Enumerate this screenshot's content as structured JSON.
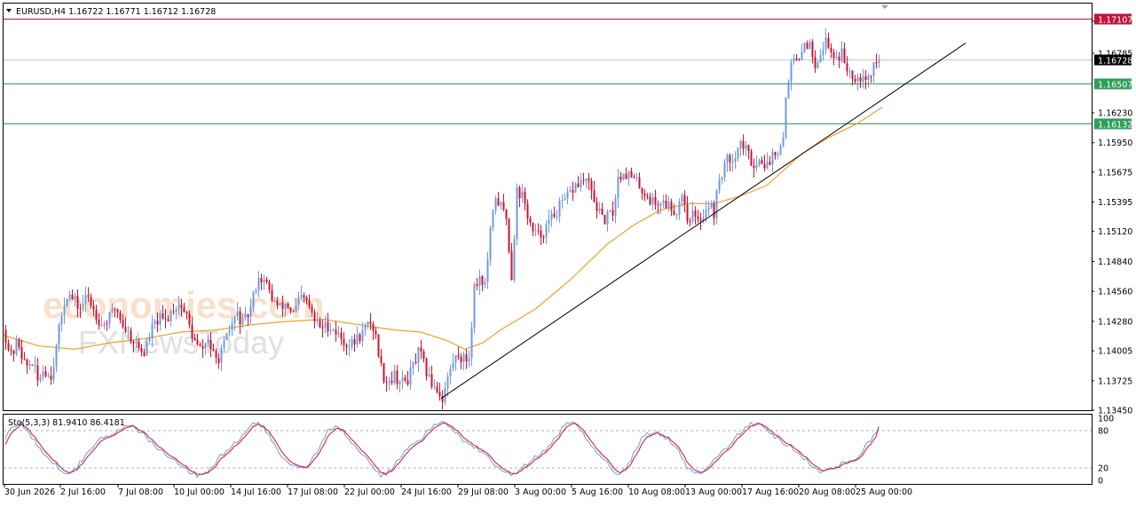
{
  "header": {
    "symbol_line": "EURUSD,H4  1.16722 1.16771 1.16712 1.16728"
  },
  "watermark": {
    "line1": "economies.com",
    "line2": "FXNewsToday"
  },
  "colors": {
    "bull": "#6f9ae0",
    "bear": "#d0112b",
    "ma": "#f0a030",
    "trend": "#000000",
    "support": "#2e9e5a",
    "resistance": "#c0143c",
    "current": "#000000",
    "stoch_main": "#6f9ae0",
    "stoch_signal": "#d0112b"
  },
  "chart_data": [
    {
      "type": "candlestick",
      "symbol": "EURUSD",
      "timeframe": "H4",
      "ohlc_last": {
        "open": 1.16722,
        "high": 1.16771,
        "low": 1.16712,
        "close": 1.16728
      },
      "ylim": [
        1.1345,
        1.1725
      ],
      "y_ticks": [
        "1.17085",
        "1.16785",
        "1.16230",
        "1.15950",
        "1.15675",
        "1.15395",
        "1.15120",
        "1.14840",
        "1.14560",
        "1.14280",
        "1.14005",
        "1.13725",
        "1.13450"
      ],
      "x_ticks": [
        "30 Jun 2026",
        "2 Jul 16:00",
        "7 Jul 08:00",
        "10 Jul 00:00",
        "14 Jul 16:00",
        "17 Jul 08:00",
        "22 Jul 00:00",
        "24 Jul 16:00",
        "29 Jul 08:00",
        "3 Aug 00:00",
        "5 Aug 16:00",
        "10 Aug 08:00",
        "13 Aug 00:00",
        "17 Aug 16:00",
        "20 Aug 08:00",
        "25 Aug 00:00"
      ],
      "horizontal_levels": [
        {
          "label": "1.17107",
          "value": 1.17107,
          "role": "resistance"
        },
        {
          "label": "1.16728",
          "value": 1.16728,
          "role": "current"
        },
        {
          "label": "1.16507",
          "value": 1.16507,
          "role": "support"
        },
        {
          "label": "1.16132",
          "value": 1.16132,
          "role": "support"
        }
      ],
      "close_path": [
        [
          0,
          1.142
        ],
        [
          8,
          1.1395
        ],
        [
          16,
          1.141
        ],
        [
          24,
          1.1385
        ],
        [
          32,
          1.139
        ],
        [
          38,
          1.1372
        ],
        [
          45,
          1.1385
        ],
        [
          52,
          1.1375
        ],
        [
          58,
          1.1398
        ],
        [
          64,
          1.143
        ],
        [
          70,
          1.1455
        ],
        [
          78,
          1.1448
        ],
        [
          86,
          1.144
        ],
        [
          94,
          1.1452
        ],
        [
          102,
          1.1438
        ],
        [
          110,
          1.1425
        ],
        [
          118,
          1.143
        ],
        [
          126,
          1.1442
        ],
        [
          134,
          1.1425
        ],
        [
          142,
          1.1415
        ],
        [
          150,
          1.1405
        ],
        [
          158,
          1.1398
        ],
        [
          166,
          1.142
        ],
        [
          174,
          1.143
        ],
        [
          182,
          1.1428
        ],
        [
          190,
          1.144
        ],
        [
          198,
          1.1445
        ],
        [
          206,
          1.1432
        ],
        [
          214,
          1.141
        ],
        [
          222,
          1.14
        ],
        [
          230,
          1.1412
        ],
        [
          238,
          1.139
        ],
        [
          246,
          1.14
        ],
        [
          254,
          1.142
        ],
        [
          262,
          1.1435
        ],
        [
          270,
          1.1425
        ],
        [
          278,
          1.144
        ],
        [
          286,
          1.147
        ],
        [
          294,
          1.1465
        ],
        [
          302,
          1.145
        ],
        [
          310,
          1.144
        ],
        [
          318,
          1.1445
        ],
        [
          326,
          1.1435
        ],
        [
          334,
          1.145
        ],
        [
          342,
          1.1445
        ],
        [
          350,
          1.1428
        ],
        [
          358,
          1.1422
        ],
        [
          366,
          1.1425
        ],
        [
          374,
          1.1418
        ],
        [
          382,
          1.141
        ],
        [
          390,
          1.1405
        ],
        [
          398,
          1.1412
        ],
        [
          406,
          1.142
        ],
        [
          414,
          1.1428
        ],
        [
          420,
          1.141
        ],
        [
          426,
          1.138
        ],
        [
          432,
          1.1372
        ],
        [
          440,
          1.1378
        ],
        [
          448,
          1.137
        ],
        [
          456,
          1.1375
        ],
        [
          462,
          1.1388
        ],
        [
          468,
          1.14
        ],
        [
          474,
          1.1385
        ],
        [
          480,
          1.1372
        ],
        [
          486,
          1.1368
        ],
        [
          494,
          1.1356
        ],
        [
          500,
          1.1375
        ],
        [
          506,
          1.139
        ],
        [
          512,
          1.1398
        ],
        [
          518,
          1.1392
        ],
        [
          524,
          1.1395
        ],
        [
          530,
          1.146
        ],
        [
          536,
          1.147
        ],
        [
          542,
          1.1462
        ],
        [
          548,
          1.151
        ],
        [
          554,
          1.1545
        ],
        [
          560,
          1.1535
        ],
        [
          566,
          1.1525
        ],
        [
          572,
          1.147
        ],
        [
          578,
          1.155
        ],
        [
          584,
          1.1545
        ],
        [
          590,
          1.1528
        ],
        [
          596,
          1.151
        ],
        [
          602,
          1.1508
        ],
        [
          608,
          1.1512
        ],
        [
          614,
          1.152
        ],
        [
          620,
          1.1528
        ],
        [
          626,
          1.1535
        ],
        [
          632,
          1.154
        ],
        [
          638,
          1.1548
        ],
        [
          644,
          1.1555
        ],
        [
          650,
          1.1558
        ],
        [
          656,
          1.156
        ],
        [
          662,
          1.1548
        ],
        [
          668,
          1.1535
        ],
        [
          674,
          1.1522
        ],
        [
          680,
          1.1525
        ],
        [
          686,
          1.153
        ],
        [
          692,
          1.1562
        ],
        [
          698,
          1.1568
        ],
        [
          704,
          1.1565
        ],
        [
          710,
          1.156
        ],
        [
          716,
          1.1555
        ],
        [
          722,
          1.1548
        ],
        [
          728,
          1.1542
        ],
        [
          734,
          1.1538
        ],
        [
          740,
          1.154
        ],
        [
          746,
          1.1538
        ],
        [
          752,
          1.1535
        ],
        [
          758,
          1.153
        ],
        [
          764,
          1.155
        ],
        [
          770,
          1.1525
        ],
        [
          776,
          1.1528
        ],
        [
          782,
          1.152
        ],
        [
          788,
          1.153
        ],
        [
          794,
          1.1538
        ],
        [
          800,
          1.153
        ],
        [
          806,
          1.156
        ],
        [
          812,
          1.1575
        ],
        [
          818,
          1.158
        ],
        [
          824,
          1.1585
        ],
        [
          830,
          1.1595
        ],
        [
          836,
          1.1588
        ],
        [
          842,
          1.1578
        ],
        [
          848,
          1.1575
        ],
        [
          854,
          1.158
        ],
        [
          860,
          1.1572
        ],
        [
          866,
          1.1585
        ],
        [
          872,
          1.159
        ],
        [
          878,
          1.16
        ],
        [
          882,
          1.165
        ],
        [
          886,
          1.1665
        ],
        [
          890,
          1.1672
        ],
        [
          896,
          1.1668
        ],
        [
          902,
          1.169
        ],
        [
          908,
          1.1685
        ],
        [
          914,
          1.167
        ],
        [
          920,
          1.168
        ],
        [
          926,
          1.169
        ],
        [
          932,
          1.168
        ],
        [
          938,
          1.1675
        ],
        [
          944,
          1.1678
        ],
        [
          950,
          1.1665
        ],
        [
          956,
          1.166
        ],
        [
          962,
          1.1656
        ],
        [
          968,
          1.166
        ],
        [
          974,
          1.1655
        ],
        [
          980,
          1.1668
        ],
        [
          986,
          1.1672
        ],
        [
          990,
          1.16728
        ]
      ],
      "moving_average": [
        [
          0,
          1.1415
        ],
        [
          40,
          1.1405
        ],
        [
          80,
          1.1402
        ],
        [
          120,
          1.1408
        ],
        [
          160,
          1.1412
        ],
        [
          200,
          1.1418
        ],
        [
          240,
          1.142
        ],
        [
          280,
          1.1425
        ],
        [
          320,
          1.1428
        ],
        [
          360,
          1.143
        ],
        [
          400,
          1.1425
        ],
        [
          440,
          1.142
        ],
        [
          470,
          1.1418
        ],
        [
          500,
          1.141
        ],
        [
          520,
          1.1402
        ],
        [
          540,
          1.1408
        ],
        [
          560,
          1.142
        ],
        [
          600,
          1.144
        ],
        [
          640,
          1.1468
        ],
        [
          680,
          1.15
        ],
        [
          710,
          1.1518
        ],
        [
          740,
          1.1532
        ],
        [
          770,
          1.1538
        ],
        [
          800,
          1.1538
        ],
        [
          830,
          1.1545
        ],
        [
          860,
          1.1555
        ],
        [
          880,
          1.157
        ],
        [
          900,
          1.1585
        ],
        [
          930,
          1.16
        ],
        [
          960,
          1.1612
        ],
        [
          990,
          1.1628
        ]
      ],
      "trendline": {
        "start": [
          497,
          1.1356
        ],
        "end": [
          1088,
          1.1688
        ]
      }
    },
    {
      "type": "line",
      "indicator_label": "Sto(5,3,3) 81.9410 86.4181",
      "ylim": [
        0,
        100
      ],
      "y_ticks": [
        "100",
        "80",
        "20",
        "0"
      ],
      "levels": [
        80,
        20
      ],
      "main_last": 81.941,
      "signal_last": 86.4181
    }
  ]
}
